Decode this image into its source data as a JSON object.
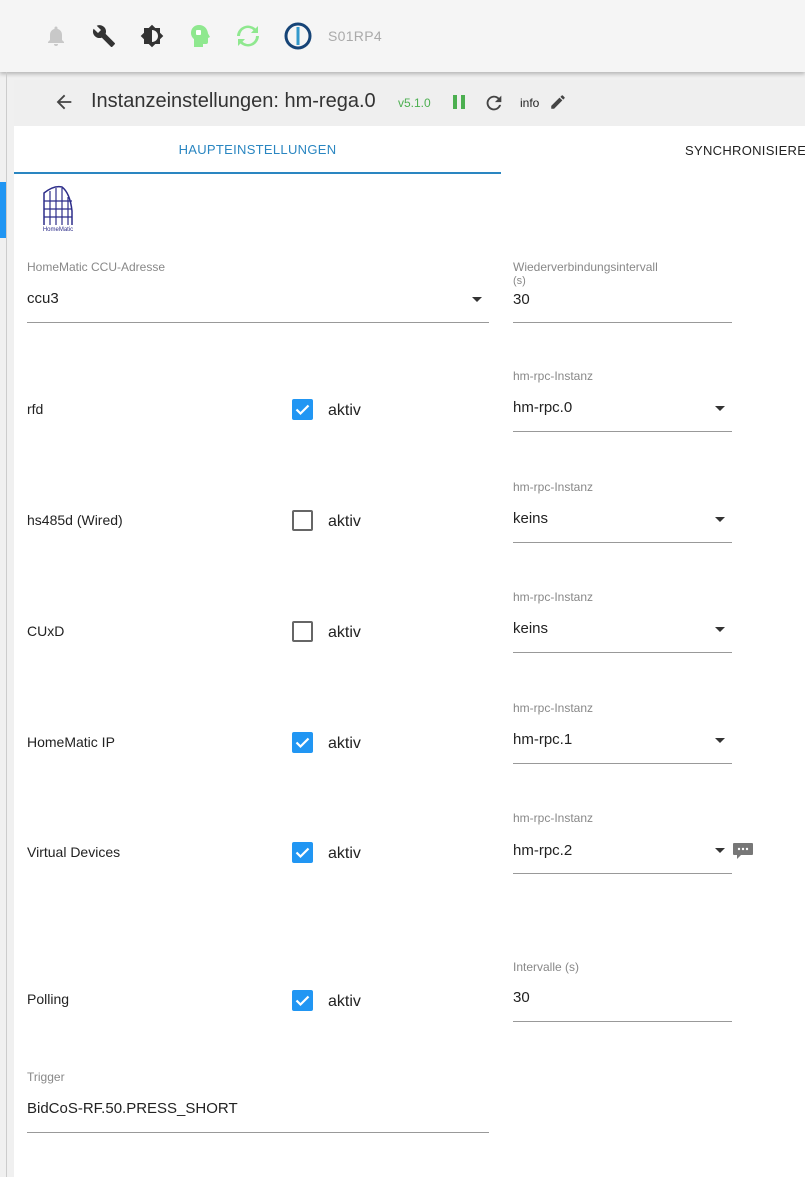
{
  "appbar": {
    "host": "S01RP4",
    "icons": [
      "bell-icon",
      "wrench-icon",
      "brightness-icon",
      "head-icon",
      "sync-icon",
      "iobroker-logo"
    ]
  },
  "header": {
    "title": "Instanzeinstellungen: hm-rega.0",
    "version": "v5.1.0",
    "info_label": "info"
  },
  "tabs": {
    "main": "Haupteinstellungen",
    "sync": "Synchronisiere"
  },
  "logo_text": "HomeMatic",
  "ccu": {
    "label": "HomeMatic CCU-Adresse",
    "value": "ccu3"
  },
  "reconnect": {
    "label_line1": "Wiederverbindungsintervall",
    "label_line2": "(s)",
    "value": "30"
  },
  "rows": [
    {
      "name": "rfd",
      "checked": true,
      "checkbox_label": "aktiv",
      "instance_label": "hm-rpc-Instanz",
      "instance_value": "hm-rpc.0"
    },
    {
      "name": "hs485d (Wired)",
      "checked": false,
      "checkbox_label": "aktiv",
      "instance_label": "hm-rpc-Instanz",
      "instance_value": "keins"
    },
    {
      "name": "CUxD",
      "checked": false,
      "checkbox_label": "aktiv",
      "instance_label": "hm-rpc-Instanz",
      "instance_value": "keins"
    },
    {
      "name": "HomeMatic IP",
      "checked": true,
      "checkbox_label": "aktiv",
      "instance_label": "hm-rpc-Instanz",
      "instance_value": "hm-rpc.1"
    },
    {
      "name": "Virtual Devices",
      "checked": true,
      "checkbox_label": "aktiv",
      "instance_label": "hm-rpc-Instanz",
      "instance_value": "hm-rpc.2"
    }
  ],
  "polling": {
    "name": "Polling",
    "checked": true,
    "checkbox_label": "aktiv",
    "interval_label": "Intervalle (s)",
    "interval_value": "30"
  },
  "trigger": {
    "label": "Trigger",
    "value": "BidCoS-RF.50.PRESS_SHORT"
  },
  "colors": {
    "accent": "#2a86c1",
    "checkbox": "#2196f3",
    "version": "#4caf50",
    "icon_green": "#8fe88f"
  }
}
